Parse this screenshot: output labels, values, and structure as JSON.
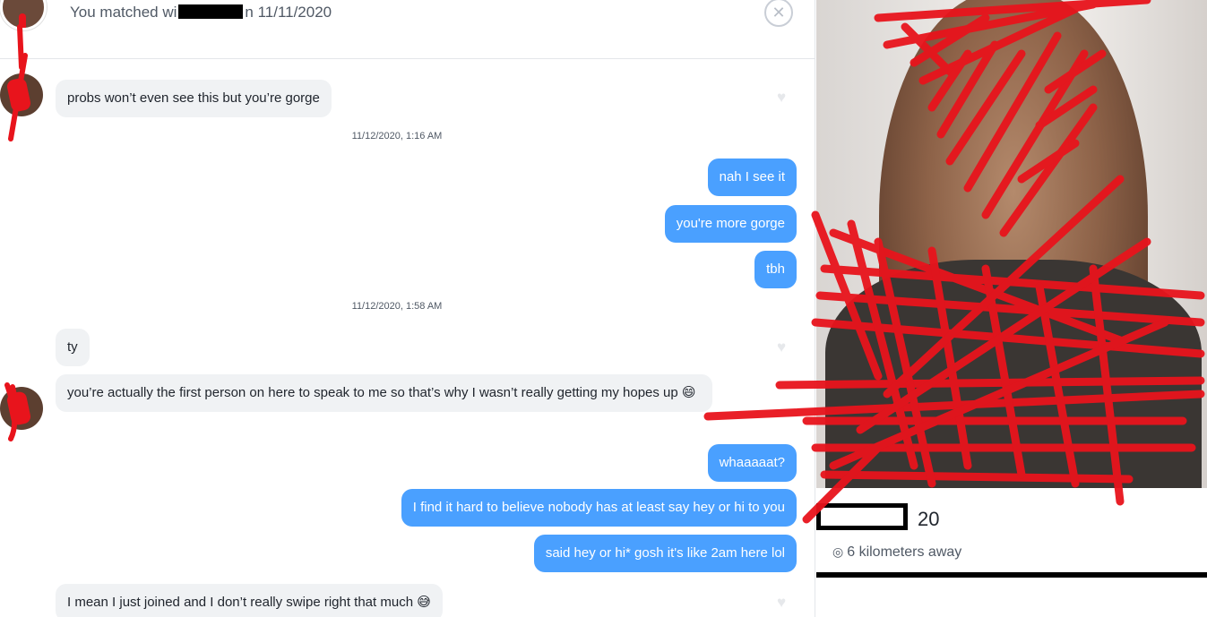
{
  "header": {
    "match_prefix": "You matched wi",
    "match_suffix": "n 11/11/2020",
    "close_icon": "close-icon"
  },
  "messages": [
    {
      "side": "in",
      "text": "probs won’t even see this but you’re gorge"
    },
    {
      "side": "ts",
      "text": "11/12/2020, 1:16 AM"
    },
    {
      "side": "out",
      "text": "nah I see it"
    },
    {
      "side": "out",
      "text": "you're more gorge"
    },
    {
      "side": "out",
      "text": "tbh"
    },
    {
      "side": "ts",
      "text": "11/12/2020, 1:58 AM"
    },
    {
      "side": "in",
      "text": "ty"
    },
    {
      "side": "in",
      "text": "you’re actually the first person on here to speak to me so that’s why I wasn’t really getting my hopes up 😄"
    },
    {
      "side": "out",
      "text": "whaaaaat?"
    },
    {
      "side": "out",
      "text": "I find it hard to believe nobody has at least say hey or hi to you"
    },
    {
      "side": "out",
      "text": "said hey or hi* gosh it's like 2am here lol"
    },
    {
      "side": "in",
      "text": "I mean I just joined and I don’t really swipe right that much 😅"
    }
  ],
  "profile": {
    "age": "20",
    "distance": "6 kilometers away",
    "pin_icon": "location-pin-icon"
  },
  "colors": {
    "outgoing_bubble": "#4aa0ff",
    "incoming_bubble": "#f0f2f4",
    "redaction_red": "#e8141c"
  }
}
